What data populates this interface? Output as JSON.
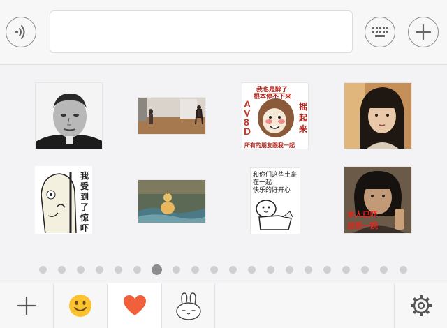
{
  "input_bar": {
    "voice_icon": "voice-wave-icon",
    "text_value": "",
    "keyboard_icon": "keyboard-icon",
    "more_icon": "plus-icon"
  },
  "stickers": [
    {
      "label": "Man portrait grayscale photo"
    },
    {
      "label": "Dance room video still"
    },
    {
      "text_lines": [
        "我也是醉了",
        "根本停不下来",
        "AV8D",
        "摇起来",
        "所有的朋友跟我一起"
      ]
    },
    {
      "label": "Girl selfie photo"
    },
    {
      "text_lines": [
        "我受到了惊吓"
      ]
    },
    {
      "label": "Golden gourd painting"
    },
    {
      "text_lines": [
        "和你们这些土豪",
        "在一起",
        "快乐的好开心"
      ]
    },
    {
      "text_lines": [
        "本人已吓",
        "送到一院"
      ]
    }
  ],
  "pager": {
    "count": 20,
    "active_index": 6
  },
  "tabs": [
    {
      "name": "add",
      "icon": "plus-icon"
    },
    {
      "name": "emoji",
      "icon": "smiley-face-icon"
    },
    {
      "name": "favorites",
      "icon": "heart-icon",
      "selected": true
    },
    {
      "name": "rabbit-stickers",
      "icon": "rabbit-icon"
    }
  ],
  "settings_icon": "gear-icon",
  "colors": {
    "heart": "#f0603a",
    "emoji": "#f9c22e",
    "dot_active": "#8c8c8c",
    "dot": "#cfcfd2"
  }
}
